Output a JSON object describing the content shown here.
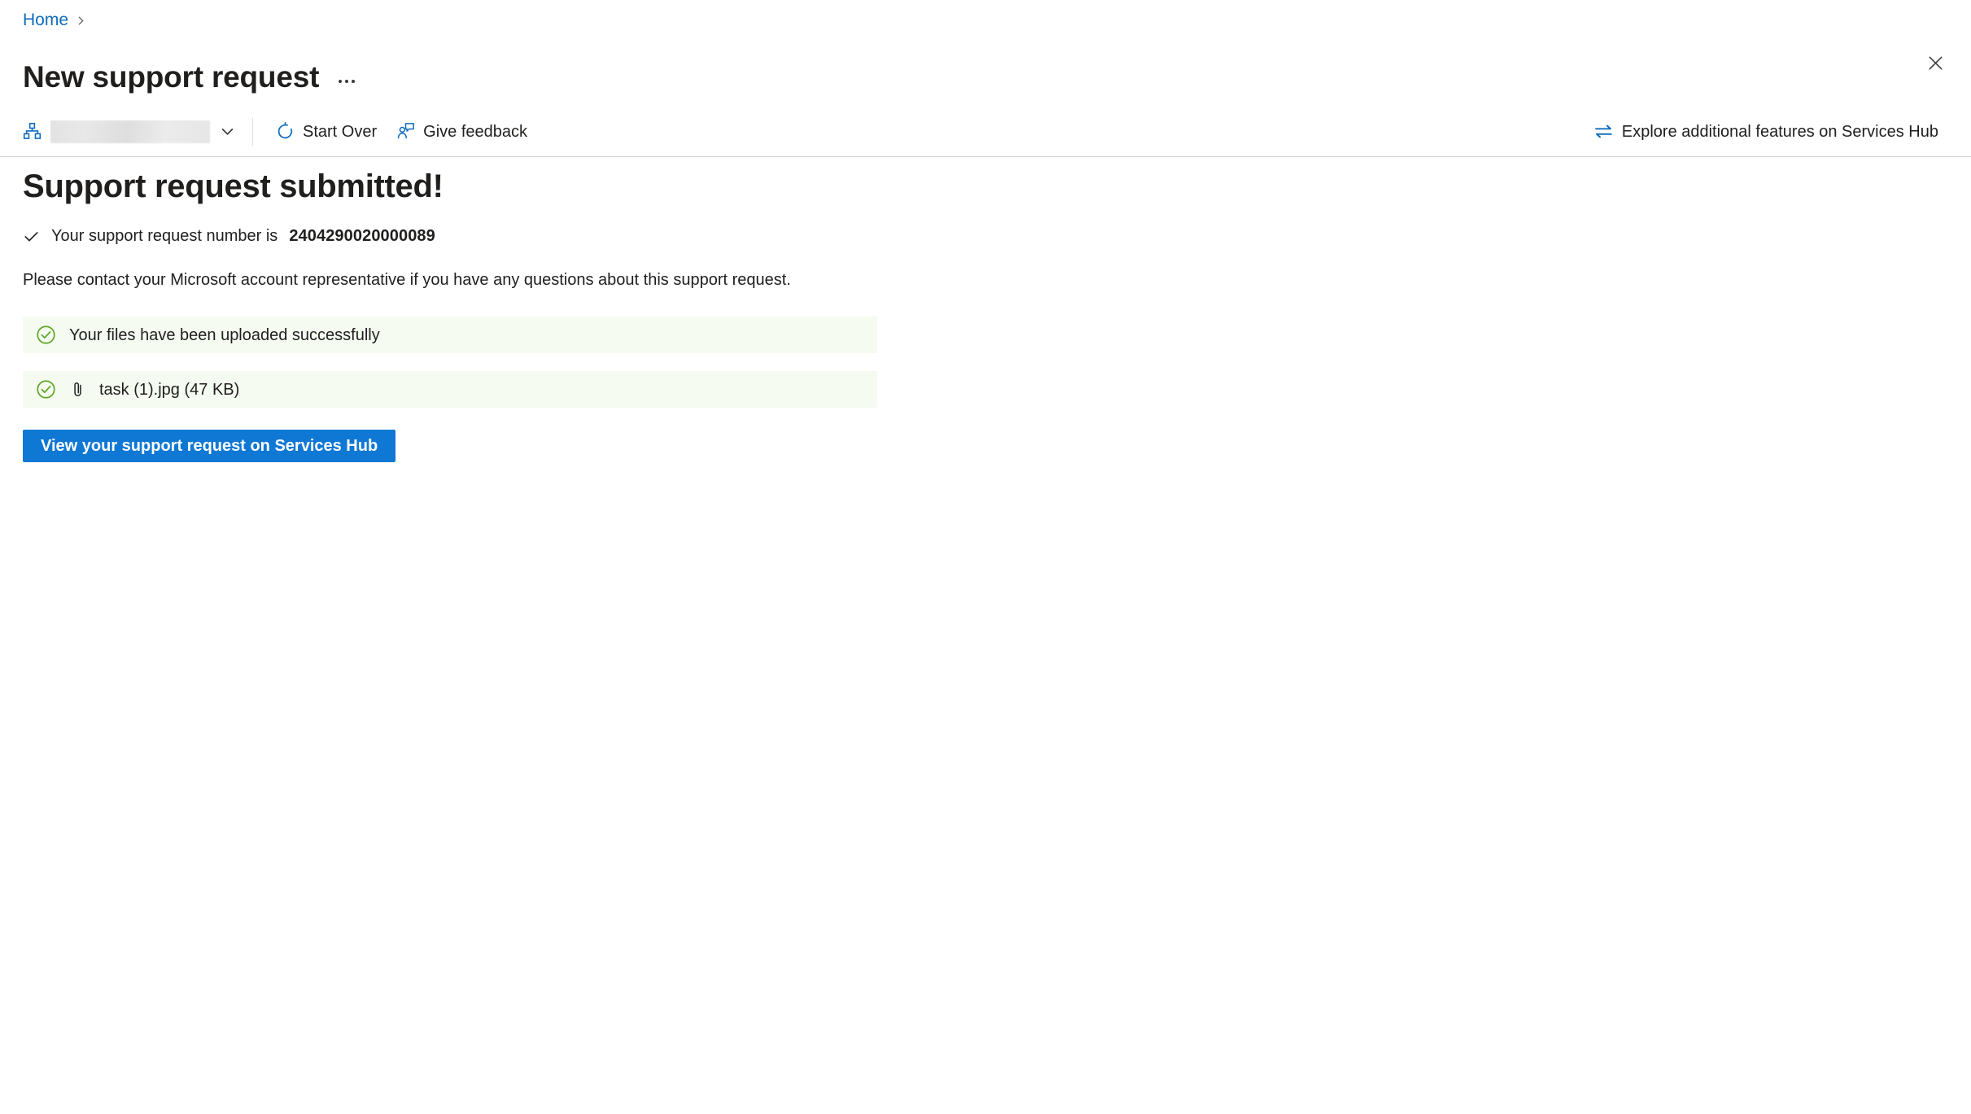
{
  "breadcrumb": {
    "home_label": "Home",
    "separator": "›"
  },
  "header": {
    "title": "New support request",
    "more_options_label": "…",
    "close_label": "✕"
  },
  "command_bar": {
    "scope_picker": {
      "icon": "org-hierarchy-icon",
      "value": "",
      "redacted": true,
      "chevron": "chevron-down-icon"
    },
    "start_over_label": "Start Over",
    "give_feedback_label": "Give feedback",
    "services_hub_link_label": "Explore additional features on Services Hub"
  },
  "main": {
    "headline": "Support request submitted!",
    "confirm_prefix": "Your support request number is",
    "ticket_number": "2404290020000089",
    "info_paragraph": "Please contact your Microsoft account representative if you have any questions about this support request.",
    "banners": [
      {
        "icon": "check-circle-icon",
        "has_attachment_icon": false,
        "text": "Your files have been uploaded successfully"
      },
      {
        "icon": "check-circle-icon",
        "has_attachment_icon": true,
        "attachment_icon": "paperclip-icon",
        "text": "task (1).jpg (47 KB)"
      }
    ],
    "primary_button_label": "View your support request on Services Hub"
  },
  "colors": {
    "link_blue": "#0f6cbd",
    "primary_button": "#0f78d4",
    "success_green": "#5fa524",
    "banner_background": "#f5fbf1",
    "text_primary": "#201f1e",
    "divider": "#d1d1d1"
  }
}
